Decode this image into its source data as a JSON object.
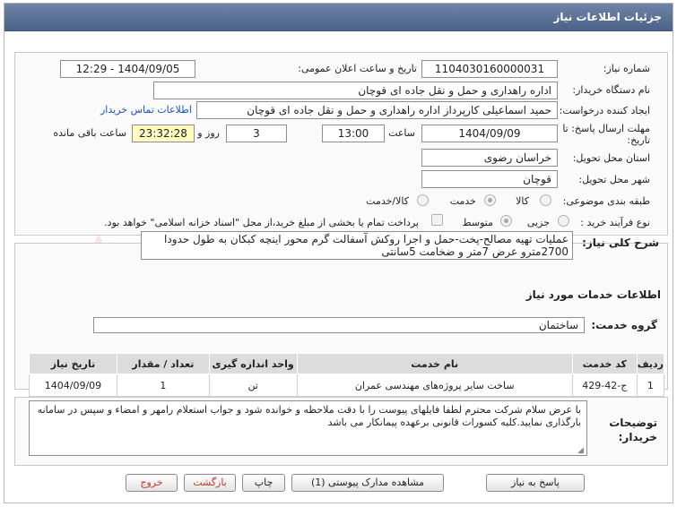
{
  "header": {
    "title": "جزئیات اطلاعات نیاز"
  },
  "labels": {
    "need_number": "شماره نیاز:",
    "announce_datetime": "تاریخ و ساعت اعلان عمومی:",
    "buyer_org": "نام دستگاه خریدار:",
    "requester": "ایجاد کننده درخواست:",
    "reply_deadline_line1": "مهلت ارسال پاسخ: تا",
    "reply_deadline_line2": "تاریخ:",
    "time": "ساعت",
    "days_and": "روز و",
    "remaining": "ساعت باقی مانده",
    "province": "استان محل تحویل:",
    "city": "شهر محل تحویل:",
    "category": "طبقه بندی موضوعی:",
    "process_type": "نوع فرآیند خرید :",
    "need_description": "شرح کلی نیاز:",
    "services_info": "اطلاعات خدمات مورد نیاز",
    "service_group": "گروه خدمت:",
    "buyer_notes_line1": "توضیحات",
    "buyer_notes_line2": "خریدار:"
  },
  "fields": {
    "need_number": "1104030160000031",
    "announce_datetime": "1404/09/05 - 12:29",
    "buyer_org": "اداره راهداری و حمل و نقل جاده ای قوچان",
    "requester": "حمید اسماعیلی کارپرداز اداره راهداری و حمل و نقل جاده ای قوچان",
    "contact_link": "اطلاعات تماس خریدار",
    "deadline_date": "1404/09/09",
    "deadline_time": "13:00",
    "days": "3",
    "remaining_time": "23:32:28",
    "province": "خراسان رضوی",
    "city": "قوچان",
    "description": "عملیات تهیه مصالح-پخت-حمل و اجرا روکش آسفالت گرم محور اینچه کبکان به طول حدودا 2700مترو عرض 7متر و ضخامت 5سانتی",
    "service_group": "ساختمان",
    "buyer_notes": "با عرض سلام شرکت محترم  لطفا فایلهای پیوست را با دقت ملاحظه و خوانده شود و جواب استعلام رامهر و امضاء و سپس در سامانه بارگذاری نمایید.کلیه کسورات قانونی برعهده پیمانکار می باشد"
  },
  "category_options": [
    "کالا",
    "خدمت",
    "کالا/خدمت"
  ],
  "category_selected": "خدمت",
  "process_options": [
    "جزیی",
    "متوسط"
  ],
  "process_selected": "متوسط",
  "treasury_note": "پرداخت تمام یا بخشی از مبلغ خرید،از محل \"اسناد خزانه اسلامی\" خواهد بود.",
  "table": {
    "headers": [
      "ردیف",
      "کد خدمت",
      "نام خدمت",
      "واحد اندازه گیری",
      "تعداد / مقدار",
      "تاریخ نیاز"
    ],
    "rows": [
      [
        "1",
        "ج-42-429",
        "ساخت سایر پروژه‌های مهندسی عمران",
        "تن",
        "1",
        "1404/09/09"
      ]
    ]
  },
  "buttons": {
    "reply": "پاسخ به نیاز",
    "attachments": "مشاهده مدارک پیوستی (1)",
    "print": "چاپ",
    "back": "بازگشت",
    "exit": "خروج"
  },
  "watermark": {
    "text": "AriaTender.net"
  },
  "colors": {
    "header": "#5a6f95",
    "yellow": "#fffbbf",
    "link": "#1c56b3",
    "red_button_text": "#c0392b"
  }
}
